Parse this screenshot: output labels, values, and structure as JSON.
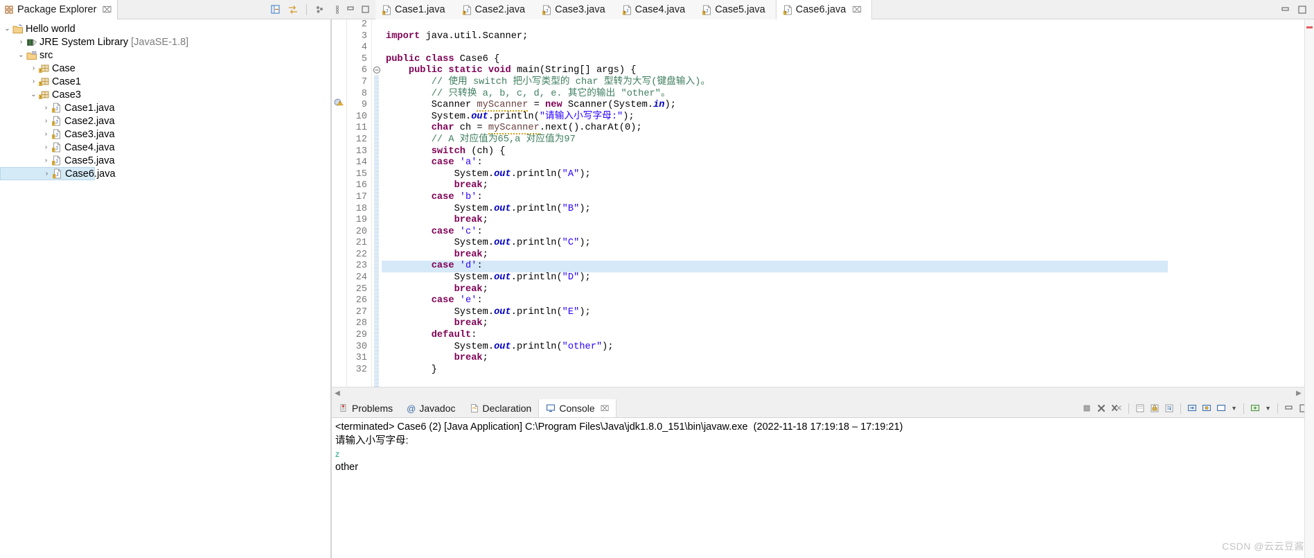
{
  "explorer": {
    "tab_label": "Package Explorer",
    "close_glyph": "⌧",
    "tools": [
      "collapse-all-icon",
      "link-with-editor-icon",
      "view-menu-icon"
    ],
    "tree": [
      {
        "label": "Hello world",
        "indent": 0,
        "arrow": "⌄",
        "icon": "java-project-icon",
        "selected": false,
        "suffix": ""
      },
      {
        "label": "JRE System Library",
        "indent": 1,
        "arrow": "›",
        "icon": "library-icon",
        "selected": false,
        "suffix": " [JavaSE-1.8]"
      },
      {
        "label": "src",
        "indent": 1,
        "arrow": "⌄",
        "icon": "source-folder-icon",
        "selected": false,
        "suffix": ""
      },
      {
        "label": "Case",
        "indent": 2,
        "arrow": "›",
        "icon": "package-icon",
        "selected": false,
        "suffix": ""
      },
      {
        "label": "Case1",
        "indent": 2,
        "arrow": "›",
        "icon": "package-icon",
        "selected": false,
        "suffix": ""
      },
      {
        "label": "Case3",
        "indent": 2,
        "arrow": "⌄",
        "icon": "package-icon",
        "selected": false,
        "suffix": ""
      },
      {
        "label": "Case1.java",
        "indent": 3,
        "arrow": "›",
        "icon": "java-file-icon",
        "selected": false,
        "suffix": ""
      },
      {
        "label": "Case2.java",
        "indent": 3,
        "arrow": "›",
        "icon": "java-file-icon",
        "selected": false,
        "suffix": ""
      },
      {
        "label": "Case3.java",
        "indent": 3,
        "arrow": "›",
        "icon": "java-file-icon",
        "selected": false,
        "suffix": ""
      },
      {
        "label": "Case4.java",
        "indent": 3,
        "arrow": "›",
        "icon": "java-file-icon",
        "selected": false,
        "suffix": ""
      },
      {
        "label": "Case5.java",
        "indent": 3,
        "arrow": "›",
        "icon": "java-file-icon",
        "selected": false,
        "suffix": ""
      },
      {
        "label": "Case6.java",
        "indent": 3,
        "arrow": "›",
        "icon": "java-file-icon",
        "selected": true,
        "suffix": ""
      }
    ]
  },
  "editor": {
    "tabs": [
      {
        "label": "Case1.java",
        "active": false
      },
      {
        "label": "Case2.java",
        "active": false
      },
      {
        "label": "Case3.java",
        "active": false
      },
      {
        "label": "Case4.java",
        "active": false
      },
      {
        "label": "Case5.java",
        "active": false
      },
      {
        "label": "Case6.java",
        "active": true
      }
    ],
    "close_glyph": "⌧",
    "window_buttons": [
      "minimize-icon",
      "maximize-icon"
    ],
    "first_visible_line": 2,
    "highlighted_line": 23,
    "lines": [
      {
        "n": 2,
        "code": ""
      },
      {
        "n": 3,
        "code": "import java.util.Scanner;"
      },
      {
        "n": 4,
        "code": ""
      },
      {
        "n": 5,
        "code": "public class Case6 {"
      },
      {
        "n": 6,
        "code": "    public static void main(String[] args) {"
      },
      {
        "n": 7,
        "code": "        // 使用 switch 把小写类型的 char 型转为大写(键盘输入)。"
      },
      {
        "n": 8,
        "code": "        // 只转换 a, b, c, d, e. 其它的输出 \"other\"。"
      },
      {
        "n": 9,
        "code": "        Scanner myScanner = new Scanner(System.in);"
      },
      {
        "n": 10,
        "code": "        System.out.println(\"请输入小写字母:\");"
      },
      {
        "n": 11,
        "code": "        char ch = myScanner.next().charAt(0);"
      },
      {
        "n": 12,
        "code": "        // A 对应值为65,a 对应值为97"
      },
      {
        "n": 13,
        "code": "        switch (ch) {"
      },
      {
        "n": 14,
        "code": "        case 'a':"
      },
      {
        "n": 15,
        "code": "            System.out.println(\"A\");"
      },
      {
        "n": 16,
        "code": "            break;"
      },
      {
        "n": 17,
        "code": "        case 'b':"
      },
      {
        "n": 18,
        "code": "            System.out.println(\"B\");"
      },
      {
        "n": 19,
        "code": "            break;"
      },
      {
        "n": 20,
        "code": "        case 'c':"
      },
      {
        "n": 21,
        "code": "            System.out.println(\"C\");"
      },
      {
        "n": 22,
        "code": "            break;"
      },
      {
        "n": 23,
        "code": "        case 'd':"
      },
      {
        "n": 24,
        "code": "            System.out.println(\"D\");"
      },
      {
        "n": 25,
        "code": "            break;"
      },
      {
        "n": 26,
        "code": "        case 'e':"
      },
      {
        "n": 27,
        "code": "            System.out.println(\"E\");"
      },
      {
        "n": 28,
        "code": "            break;"
      },
      {
        "n": 29,
        "code": "        default:"
      },
      {
        "n": 30,
        "code": "            System.out.println(\"other\");"
      },
      {
        "n": 31,
        "code": "            break;"
      },
      {
        "n": 32,
        "code": "        }"
      }
    ]
  },
  "bottom_panel": {
    "tabs": [
      {
        "label": "Problems",
        "icon": "problems-icon",
        "active": false
      },
      {
        "label": "Javadoc",
        "icon": "javadoc-icon",
        "active": false
      },
      {
        "label": "Declaration",
        "icon": "declaration-icon",
        "active": false
      },
      {
        "label": "Console",
        "icon": "console-icon",
        "active": true
      }
    ],
    "close_glyph": "⌧",
    "toolbar_icons": [
      "terminate-icon",
      "remove-launch-icon",
      "remove-all-terminated-icon",
      "clear-console-icon",
      "scroll-lock-icon",
      "word-wrap-icon",
      "show-console-on-output-icon",
      "pin-console-icon",
      "display-selected-console-icon",
      "open-console-icon",
      "view-menu-icon",
      "minimize-icon",
      "maximize-icon"
    ],
    "console": {
      "header": "<terminated> Case6 (2) [Java Application] C:\\Program Files\\Java\\jdk1.8.0_151\\bin\\javaw.exe  (2022-11-18 17:19:18 – 17:19:21)",
      "output": [
        {
          "text": "请输入小写字母:",
          "kind": "out"
        },
        {
          "text": "z",
          "kind": "input"
        },
        {
          "text": "other",
          "kind": "out"
        }
      ]
    }
  },
  "watermark": {
    "text": "CSDN @云云豆酱"
  },
  "colors": {
    "keyword": "#7f0055",
    "string": "#2a00ff",
    "comment": "#3f7f5f",
    "field": "#0000c0",
    "selection": "#d4eaf7",
    "line_highlight": "#d6e9f8",
    "console_input": "#16a085"
  }
}
